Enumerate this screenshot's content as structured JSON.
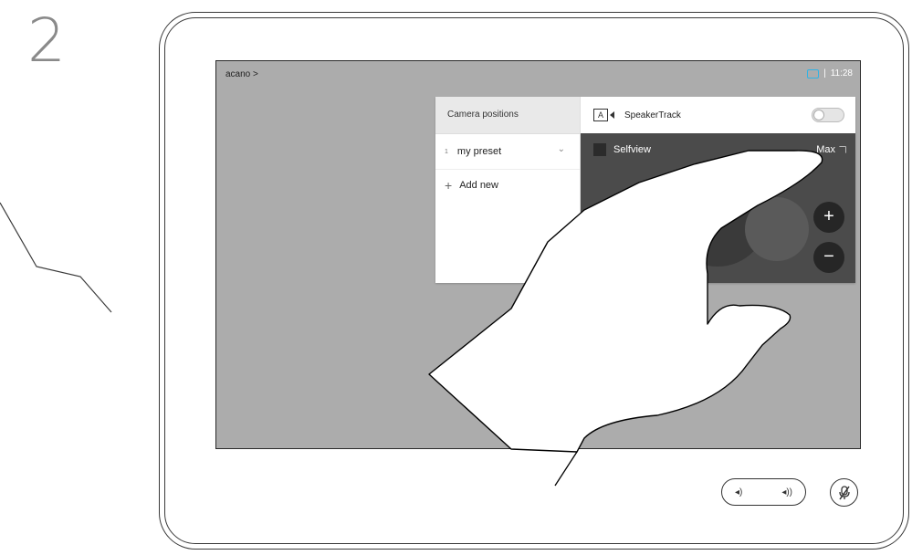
{
  "step": {
    "number": "2"
  },
  "screen": {
    "breadcrumb": "acano >",
    "status": {
      "camera_icon": "camera-icon",
      "separator": "|",
      "time": "11:28",
      "accent": "#2fb3e6"
    }
  },
  "camera_panel": {
    "left": {
      "header": "Camera positions",
      "presets": [
        {
          "index": "1",
          "name": "my preset",
          "icon": "chevron-down-icon"
        }
      ],
      "add_new": {
        "icon": "plus-icon",
        "label": "Add new"
      }
    },
    "right": {
      "speakertrack": {
        "icon": "speakertrack-icon",
        "icon_letter": "A",
        "label": "SpeakerTrack",
        "enabled": false
      },
      "selfview": {
        "label": "Selfview",
        "maximize_label": "Max",
        "expand_icon": "expand-icon"
      },
      "zoom": {
        "in": "+",
        "out": "−"
      },
      "pan_up": "^"
    }
  },
  "device": {
    "volume": {
      "down_icon": "volume-down-icon",
      "up_icon": "volume-up-icon",
      "down": "◂)",
      "up": "◂))"
    },
    "mute_icon": "microphone-muted-icon",
    "mute_glyph": "🎙"
  }
}
